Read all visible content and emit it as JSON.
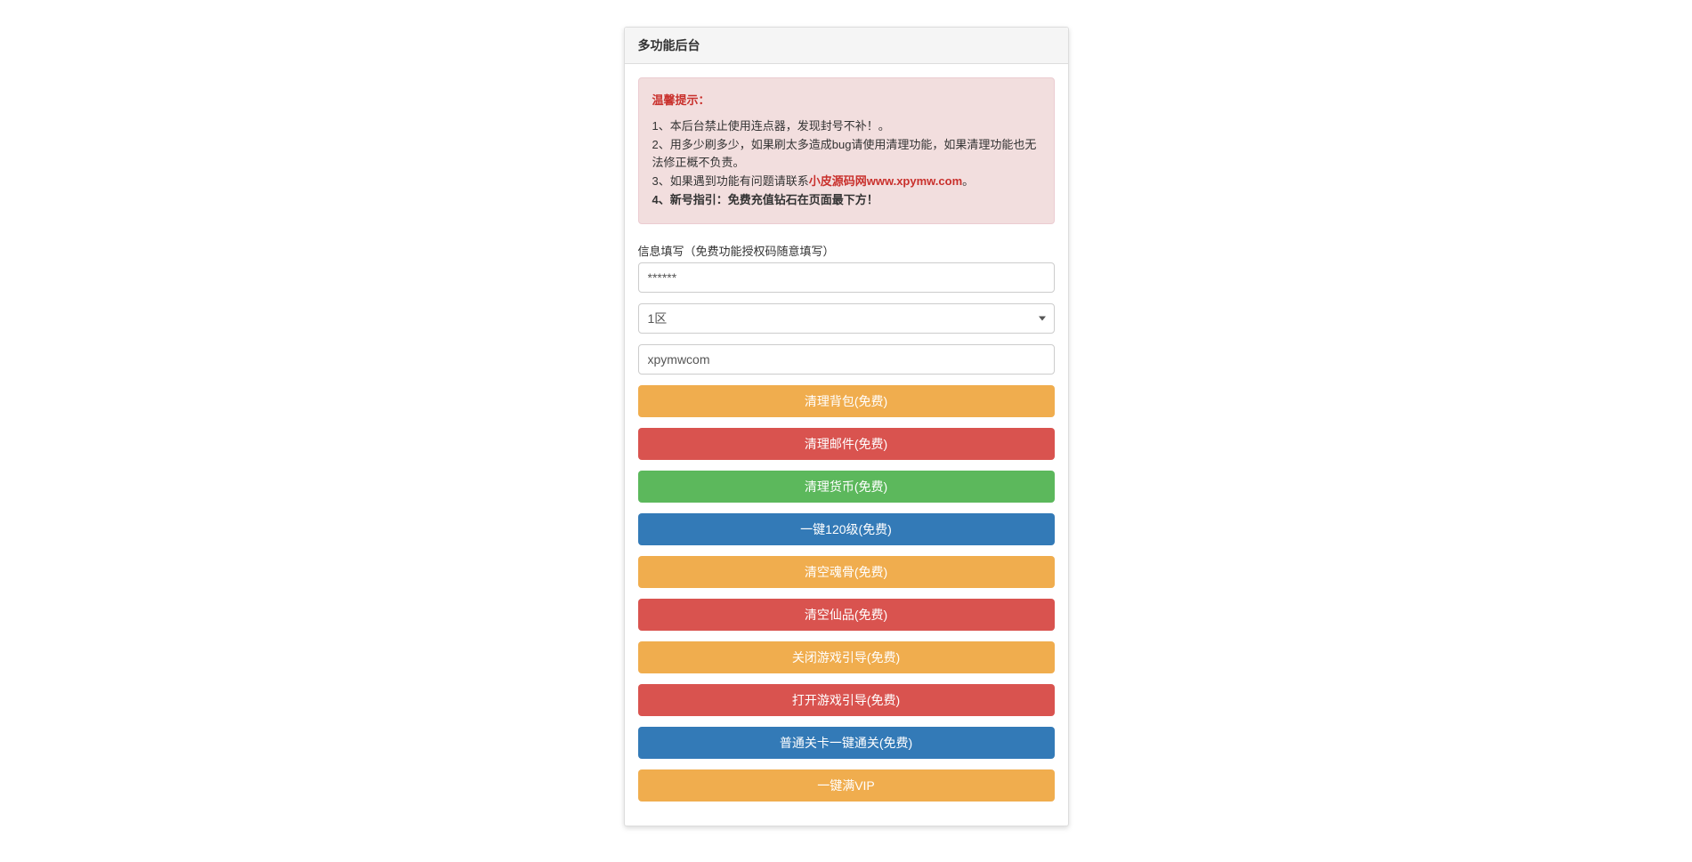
{
  "panel": {
    "title": "多功能后台"
  },
  "alert": {
    "title": "温馨提示：",
    "line1": "1、本后台禁止使用连点器，发现封号不补！。",
    "line2": "2、用多少刷多少，如果刷太多造成bug请使用清理功能，如果清理功能也无法修正概不负责。",
    "line3_prefix": "3、如果遇到功能有问题请联系",
    "line3_link": "小皮源码网www.xpymw.com",
    "line3_suffix": "。",
    "line4": "4、新号指引：免费充值钻石在页面最下方！"
  },
  "form": {
    "label": "信息填写（免费功能授权码随意填写）",
    "authcode_value": "******",
    "zone_selected": "1区",
    "username_value": "xpymwcom"
  },
  "buttons": {
    "clear_bag": "清理背包(免费)",
    "clear_mail": "清理邮件(免费)",
    "clear_currency": "清理货币(免费)",
    "level_120": "一键120级(免费)",
    "clear_soulbone": "清空魂骨(免费)",
    "clear_xianpin": "清空仙品(免费)",
    "close_guide": "关闭游戏引导(免费)",
    "open_guide": "打开游戏引导(免费)",
    "normal_pass": "普通关卡一键通关(免费)",
    "full_vip": "一键满VIP"
  }
}
